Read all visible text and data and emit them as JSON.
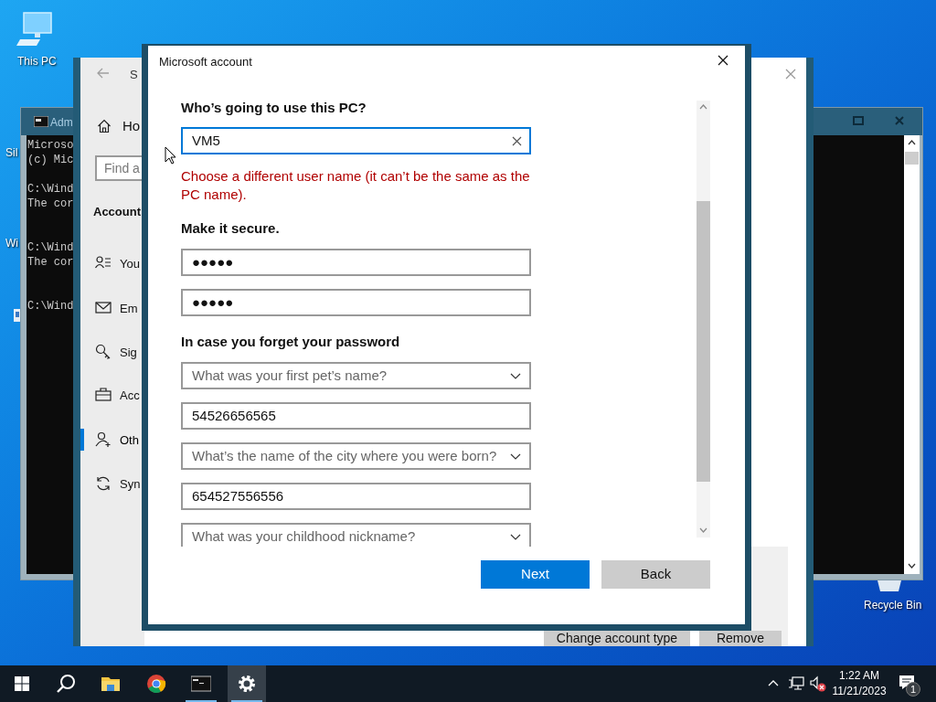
{
  "desktop_icons": [
    {
      "label": "This PC",
      "kind": "pc"
    },
    {
      "label": "Sil",
      "kind": "partial"
    },
    {
      "label": "Wi",
      "kind": "partial"
    },
    {
      "label": "Recycle Bin",
      "kind": "bin"
    }
  ],
  "cmd_window": {
    "title": "Adm",
    "blocks": [
      [
        "Microso",
        "(c) Mic"
      ],
      [
        "C:\\Wind",
        "The cor"
      ],
      [
        "C:\\Wind",
        "The cor"
      ],
      [
        "C:\\Wind"
      ]
    ]
  },
  "settings_window": {
    "title": "S",
    "home": "Ho",
    "search": {
      "placeholder": "Find a"
    },
    "section": "Account",
    "items": [
      {
        "label": "You",
        "kind": "info",
        "selected": false
      },
      {
        "label": "Em",
        "kind": "mail",
        "selected": false
      },
      {
        "label": "Sig",
        "kind": "key",
        "selected": false
      },
      {
        "label": "Acc",
        "kind": "work",
        "selected": false
      },
      {
        "label": "Oth",
        "kind": "family",
        "selected": true
      },
      {
        "label": "Syn",
        "kind": "sync",
        "selected": false
      }
    ],
    "buttons": [
      "Change account type",
      "Remove"
    ]
  },
  "dialog": {
    "title": "Microsoft account",
    "user_label": "Who’s going to use this PC?",
    "user_name": "VM5",
    "error": "Choose a different user name (it can’t be the same as the PC name).",
    "secure_label": "Make it secure.",
    "passwords": [
      "●●●●●",
      "●●●●●"
    ],
    "recovery_label": "In case you forget your password",
    "questions": [
      {
        "placeholder": "What was your first pet’s name?",
        "answer": "54526656565"
      },
      {
        "placeholder": "What’s the name of the city where you were born?",
        "answer": "654527556556"
      },
      {
        "placeholder": "What was your childhood nickname?"
      }
    ],
    "buttons": [
      {
        "label": "Next",
        "kind": "primary"
      },
      {
        "label": "Back",
        "kind": "secondary"
      }
    ]
  },
  "taskbar": {
    "apps": [
      {
        "kind": "folder",
        "running": false,
        "selected": false
      },
      {
        "kind": "chrome",
        "running": false,
        "selected": false
      },
      {
        "kind": "cmd",
        "running": true,
        "selected": false
      },
      {
        "kind": "settings",
        "running": true,
        "selected": true
      }
    ],
    "volume": {
      "muted": true
    },
    "time": "1:22 AM",
    "date": "11/21/2023",
    "notifications": "1"
  }
}
